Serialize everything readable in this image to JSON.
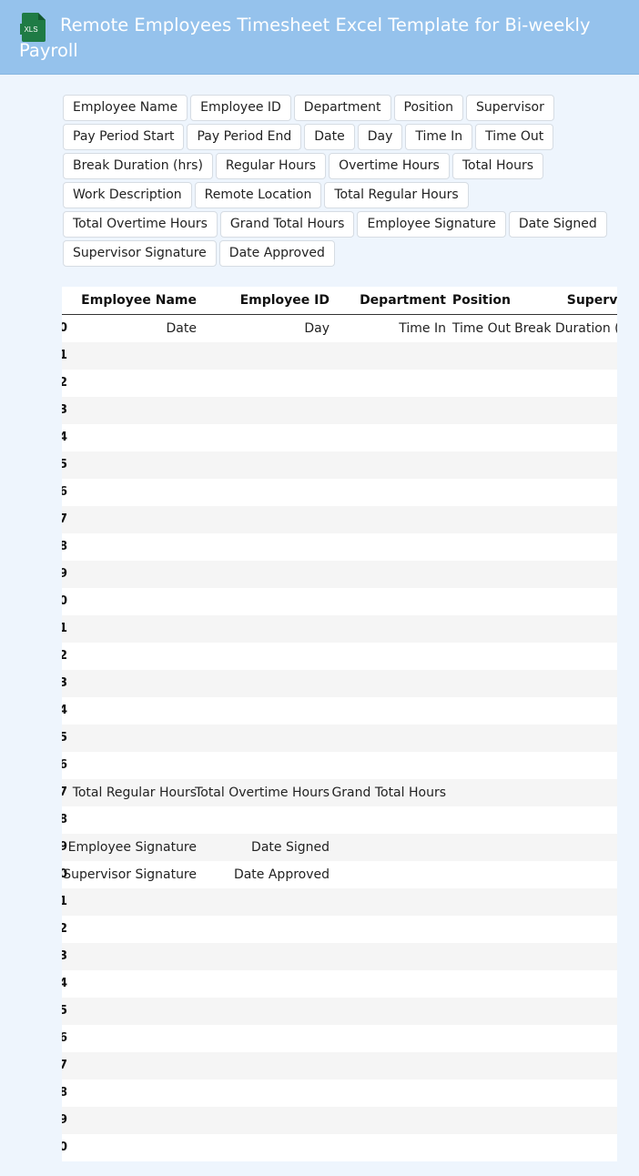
{
  "header": {
    "title": "Remote Employees Timesheet Excel Template for Bi-weekly Payroll",
    "icon_label": "XLS",
    "icon_color": "#1f7b45"
  },
  "fields": [
    "Employee Name",
    "Employee ID",
    "Department",
    "Position",
    "Supervisor",
    "Pay Period Start",
    "Pay Period End",
    "Date",
    "Day",
    "Time In",
    "Time Out",
    "Break Duration (hrs)",
    "Regular Hours",
    "Overtime Hours",
    "Total Hours",
    "Work Description",
    "Remote Location",
    "Total Regular Hours",
    "Total Overtime Hours",
    "Grand Total Hours",
    "Employee Signature",
    "Date Signed",
    "Supervisor Signature",
    "Date Approved"
  ],
  "sheet": {
    "header_row": {
      "number": "",
      "cells": [
        "Employee Name",
        "Employee ID",
        "Department",
        "Position",
        "Supervisor"
      ]
    },
    "rows": [
      {
        "number": "0",
        "cells": [
          "Date",
          "Day",
          "Time In",
          "Time Out",
          "Break Duration (hrs)"
        ]
      },
      {
        "number": "1",
        "cells": []
      },
      {
        "number": "2",
        "cells": []
      },
      {
        "number": "3",
        "cells": []
      },
      {
        "number": "4",
        "cells": []
      },
      {
        "number": "5",
        "cells": []
      },
      {
        "number": "6",
        "cells": []
      },
      {
        "number": "7",
        "cells": []
      },
      {
        "number": "8",
        "cells": []
      },
      {
        "number": "9",
        "cells": []
      },
      {
        "number": "0",
        "cells": []
      },
      {
        "number": "1",
        "cells": []
      },
      {
        "number": "2",
        "cells": []
      },
      {
        "number": "3",
        "cells": []
      },
      {
        "number": "4",
        "cells": []
      },
      {
        "number": "5",
        "cells": []
      },
      {
        "number": "6",
        "cells": []
      },
      {
        "number": "7",
        "cells": [
          "Total Regular Hours",
          "Total Overtime Hours",
          "Grand Total Hours"
        ]
      },
      {
        "number": "8",
        "cells": []
      },
      {
        "number": "9",
        "cells": [
          "Employee Signature",
          "Date Signed"
        ]
      },
      {
        "number": "0",
        "cells": [
          "Supervisor Signature",
          "Date Approved"
        ]
      },
      {
        "number": "1",
        "cells": []
      },
      {
        "number": "2",
        "cells": []
      },
      {
        "number": "3",
        "cells": []
      },
      {
        "number": "4",
        "cells": []
      },
      {
        "number": "5",
        "cells": []
      },
      {
        "number": "6",
        "cells": []
      },
      {
        "number": "7",
        "cells": []
      },
      {
        "number": "8",
        "cells": []
      },
      {
        "number": "9",
        "cells": []
      },
      {
        "number": "0",
        "cells": []
      }
    ]
  }
}
